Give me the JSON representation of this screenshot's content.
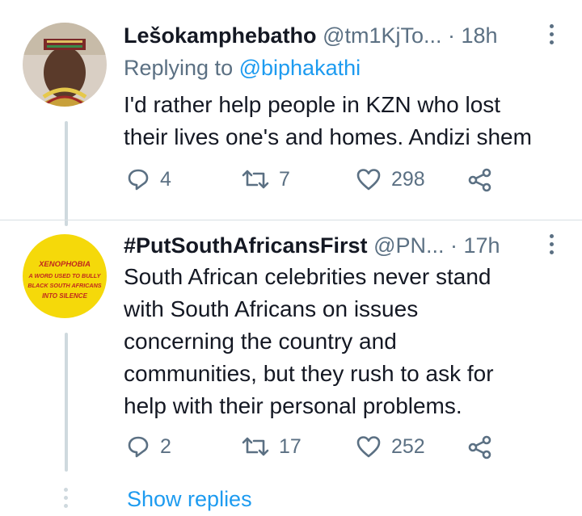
{
  "tweets": [
    {
      "display_name": "Lešokamphebatho",
      "handle": "@tm1KjTo...",
      "sep": " · ",
      "time": "18h",
      "replying_prefix": "Replying to ",
      "replying_handle": "@biphakathi",
      "lines": [
        "I'd rather help people in KZN who lost",
        "their lives one's and homes. Andizi shem"
      ],
      "replies": "4",
      "retweets": "7",
      "likes": "298"
    },
    {
      "display_name": "#PutSouthAfricansFirst",
      "handle": "@PN...",
      "sep": " · ",
      "time": "17h",
      "lines": [
        "South African celebrities never stand",
        "with South Africans on issues",
        "concerning the country and",
        "communities,  but they rush to ask for",
        "help with their personal problems."
      ],
      "replies": "2",
      "retweets": "17",
      "likes": "252",
      "avatar_text": [
        "XENOPHOBIA",
        "A WORD USED TO BULLY",
        "BLACK SOUTH AFRICANS",
        "INTO SILENCE"
      ]
    }
  ],
  "show_replies": "Show replies",
  "icons": {
    "reply": "reply-icon",
    "retweet": "retweet-icon",
    "like": "heart-icon",
    "share": "share-icon",
    "more": "more-vertical-icon"
  },
  "colors": {
    "accent": "#1d9bf0",
    "muted": "#5b7083",
    "avatar2_bg": "#f5d90a"
  }
}
